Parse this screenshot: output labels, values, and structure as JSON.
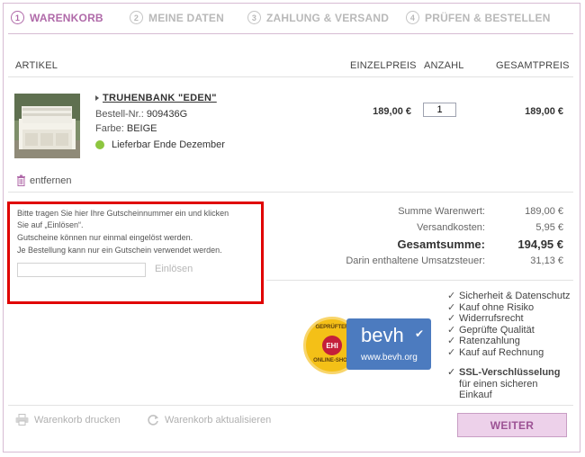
{
  "steps": [
    {
      "num": "1",
      "label": "WARENKORB"
    },
    {
      "num": "2",
      "label": "MEINE DATEN"
    },
    {
      "num": "3",
      "label": "ZAHLUNG & VERSAND"
    },
    {
      "num": "4",
      "label": "PRÜFEN & BESTELLEN"
    }
  ],
  "table": {
    "headers": {
      "artikel": "ARTIKEL",
      "einzelpreis": "EINZELPREIS",
      "anzahl": "ANZAHL",
      "gesamtpreis": "GESAMTPREIS"
    }
  },
  "item": {
    "title": "TRUHENBANK \"EDEN\"",
    "order_no_label": "Bestell-Nr.:",
    "order_no": "909436G",
    "color_label": "Farbe:",
    "color": "BEIGE",
    "availability": "Lieferbar Ende Dezember",
    "unit_price": "189,00 €",
    "quantity": "1",
    "total_price": "189,00 €",
    "remove_label": "entfernen"
  },
  "voucher": {
    "line1": "Bitte tragen Sie hier Ihre Gutscheinnummer ein und klicken",
    "line2": "Sie auf „Einlösen“.",
    "line3": "Gutscheine können nur einmal eingelöst werden.",
    "line4": "Je Bestellung kann nur ein Gutschein verwendet werden.",
    "input_value": "",
    "button_label": "Einlösen"
  },
  "totals": {
    "subtotal_label": "Summe Warenwert:",
    "subtotal": "189,00 €",
    "shipping_label": "Versandkosten:",
    "shipping": "5,95 €",
    "grand_label": "Gesamtsumme:",
    "grand": "194,95 €",
    "tax_label": "Darin enthaltene Umsatzsteuer:",
    "tax": "31,13 €"
  },
  "badges": {
    "ehi_top": "GEPRÜFTER",
    "ehi_center": "EHI",
    "ehi_bottom": "ONLINE-SHOP",
    "bevh_logo": "bevh",
    "bevh_url": "www.bevh.org"
  },
  "features": [
    "Sicherheit & Datenschutz",
    "Kauf ohne Risiko",
    "Widerrufsrecht",
    "Geprüfte Qualität",
    "Ratenzahlung",
    "Kauf auf Rechnung"
  ],
  "ssl": {
    "line1": "SSL-Verschlüsselung",
    "line2": "für einen sicheren",
    "line3": "Einkauf"
  },
  "bottom": {
    "print_label": "Warenkorb drucken",
    "update_label": "Warenkorb aktualisieren",
    "next_label": "WEITER"
  },
  "colors": {
    "accent": "#b06aa9",
    "highlight_border": "#e00000",
    "availability_dot": "#8dc63f",
    "bevh_blue": "#4c7bbf"
  }
}
